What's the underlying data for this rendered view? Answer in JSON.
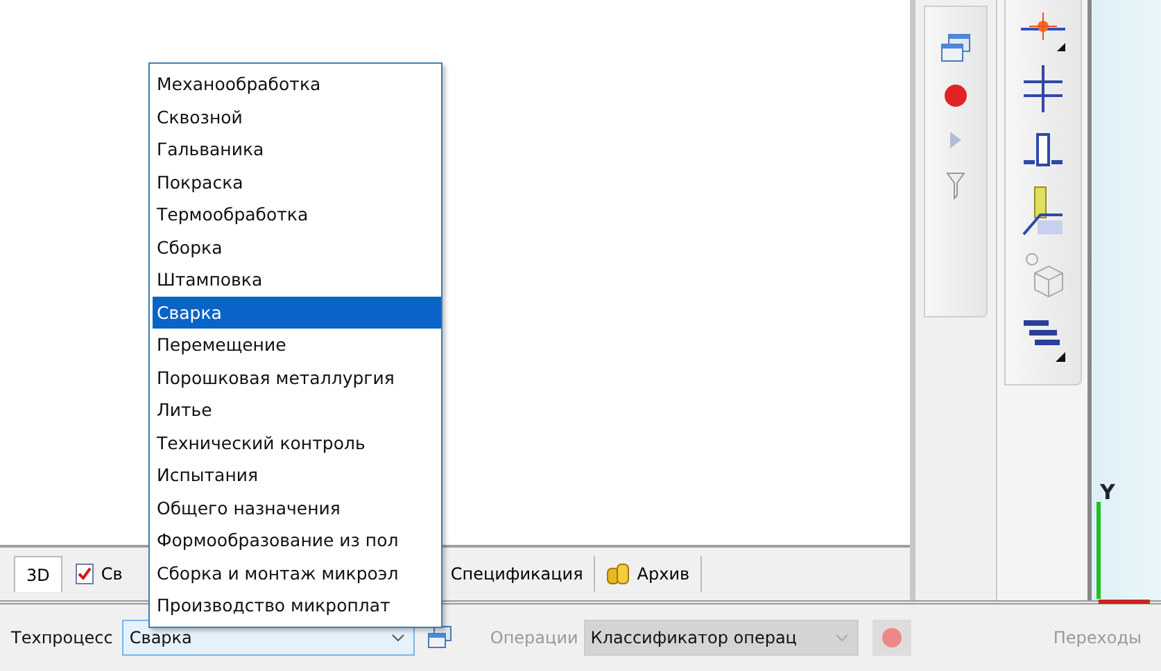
{
  "dropdown": {
    "items": [
      {
        "label": "Механообработка",
        "selected": false
      },
      {
        "label": "Сквозной",
        "selected": false
      },
      {
        "label": "Гальваника",
        "selected": false
      },
      {
        "label": "Покраска",
        "selected": false
      },
      {
        "label": "Термообработка",
        "selected": false
      },
      {
        "label": "Сборка",
        "selected": false
      },
      {
        "label": "Штамповка",
        "selected": false
      },
      {
        "label": "Сварка",
        "selected": true
      },
      {
        "label": "Перемещение",
        "selected": false
      },
      {
        "label": "Порошковая металлургия",
        "selected": false
      },
      {
        "label": "Литье",
        "selected": false
      },
      {
        "label": "Технический контроль",
        "selected": false
      },
      {
        "label": "Испытания",
        "selected": false
      },
      {
        "label": "Общего назначения",
        "selected": false
      },
      {
        "label": "Формообразование из пол",
        "selected": false
      },
      {
        "label": "Сборка и монтаж микроэл",
        "selected": false
      },
      {
        "label": "Производство микроплат",
        "selected": false
      }
    ]
  },
  "tabs": [
    {
      "label": "3D",
      "kind": "plain",
      "selected": true
    },
    {
      "label": "Св",
      "kind": "document",
      "selected": false
    },
    {
      "label": "Спецификация",
      "kind": "plain",
      "selected": false
    },
    {
      "label": "Архив",
      "kind": "archive",
      "selected": false
    }
  ],
  "toolbar": {
    "process_label": "Техпроцесс",
    "process_value": "Сварка",
    "operations_label": "Операции",
    "operations_value": "Классификатор операц",
    "operations_disabled": true,
    "transitions_label": "Переходы",
    "transitions_disabled": true
  },
  "viewport": {
    "axis_label": "Y"
  }
}
